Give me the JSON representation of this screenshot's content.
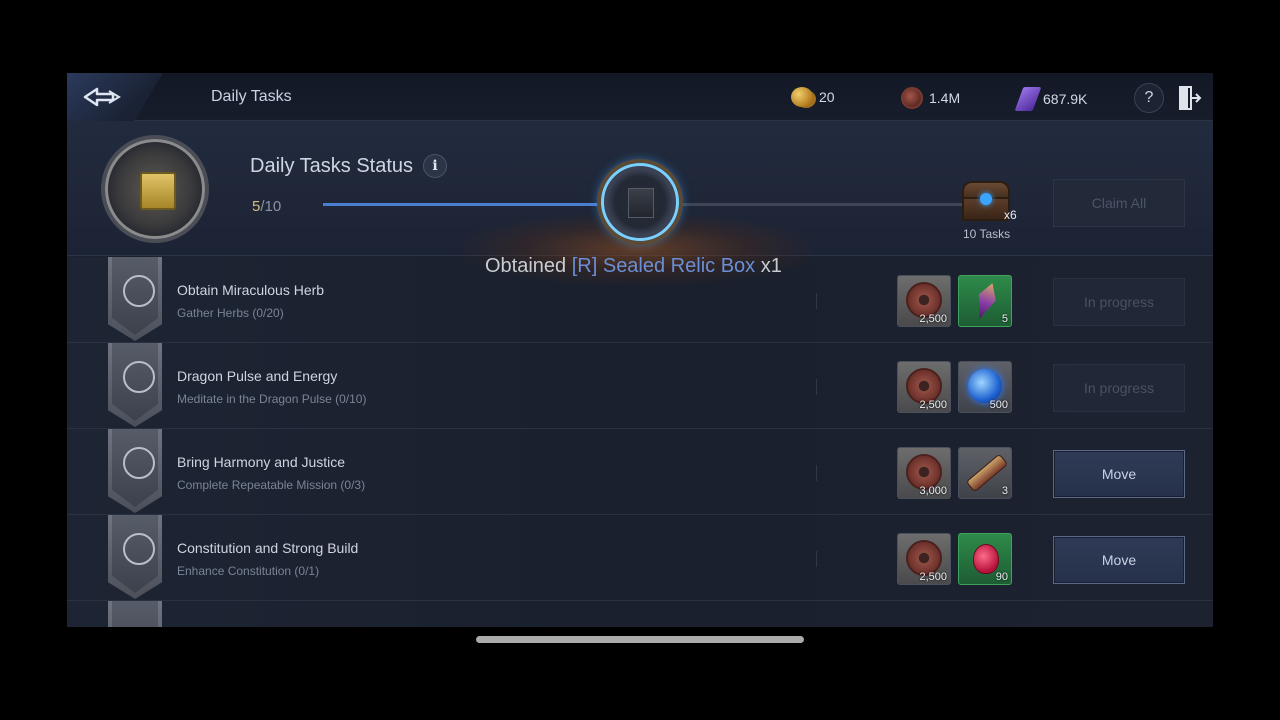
{
  "header": {
    "title": "Daily Tasks",
    "currencies": [
      {
        "icon": "gold-coins-icon",
        "value": "20"
      },
      {
        "icon": "copper-coin-icon",
        "value": "1.4M"
      },
      {
        "icon": "purple-crystal-icon",
        "value": "687.9K"
      }
    ],
    "help_label": "?"
  },
  "status": {
    "title": "Daily Tasks Status",
    "info_label": "i",
    "progress_current": "5",
    "progress_total": "/10",
    "progress_fraction": 0.5,
    "chest_qty": "x6",
    "chest_label": "10 Tasks",
    "claim_all_label": "Claim All"
  },
  "toast": {
    "prefix": "Obtained",
    "item": "[R] Sealed Relic Box",
    "suffix": "x1"
  },
  "tasks": [
    {
      "name": "Obtain Miraculous Herb",
      "sub": "Gather Herbs (0/20)",
      "reward1_qty": "2,500",
      "reward2_qty": "5",
      "action": "In progress"
    },
    {
      "name": "Dragon Pulse and Energy",
      "sub": "Meditate in the Dragon Pulse (0/10)",
      "reward1_qty": "2,500",
      "reward2_qty": "500",
      "action": "In progress"
    },
    {
      "name": "Bring Harmony and Justice",
      "sub": "Complete Repeatable Mission (0/3)",
      "reward1_qty": "3,000",
      "reward2_qty": "3",
      "action": "Move"
    },
    {
      "name": "Constitution and Strong Build",
      "sub": "Enhance Constitution (0/1)",
      "reward1_qty": "2,500",
      "reward2_qty": "90",
      "action": "Move"
    }
  ],
  "colors": {
    "progress_fill": "#4a7fd0",
    "item_name": "#6b8fd6",
    "reward_green": "#2e8a4a"
  }
}
